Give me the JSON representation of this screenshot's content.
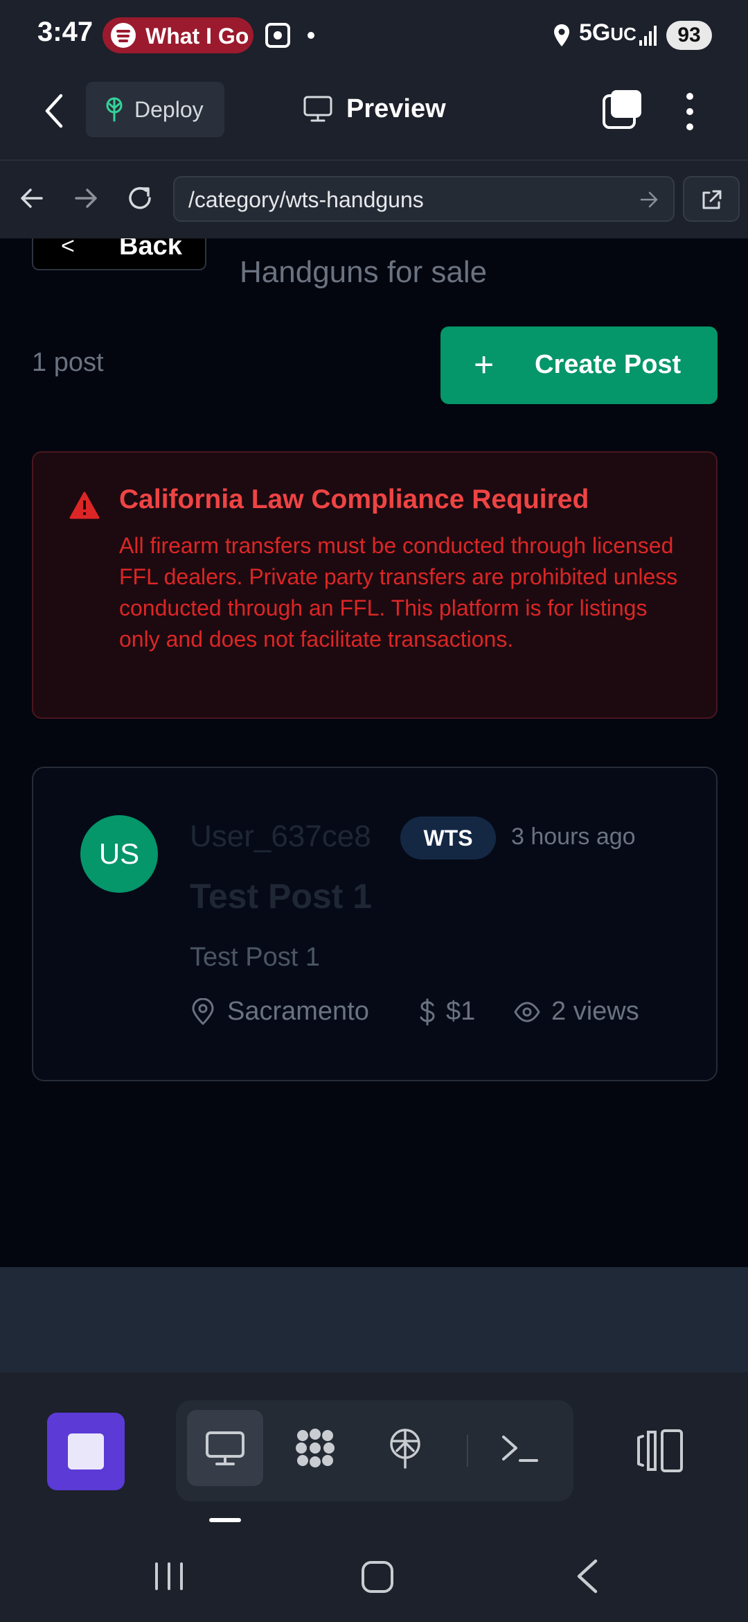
{
  "status_bar": {
    "time": "3:47",
    "media_pill": "What I Go",
    "network": "5G",
    "network_suffix": "UC",
    "battery": "93",
    "icons": [
      "spotify-icon",
      "screenshot-icon",
      "location-icon",
      "signal-icon"
    ]
  },
  "app_header": {
    "deploy_label": "Deploy",
    "preview_label": "Preview",
    "icons": [
      "back-chevron-icon",
      "deploy-tree-icon",
      "monitor-icon",
      "tabs-icon",
      "more-icon"
    ]
  },
  "url_bar": {
    "value": "/category/wts-handguns",
    "icons": [
      "arrow-left-icon",
      "arrow-right-icon",
      "reload-icon",
      "go-arrow-icon",
      "external-link-icon"
    ]
  },
  "page": {
    "back_label": "Back",
    "subtitle": "Handguns for sale",
    "post_count": "1 post",
    "create_post_label": "Create Post",
    "alert": {
      "title": "California Law Compliance Required",
      "body": "All firearm transfers must be conducted through licensed FFL dealers. Private party transfers are prohibited unless conducted through an FFL. This platform is for listings only and does not facilitate transactions."
    },
    "posts": [
      {
        "avatar": "US",
        "username": "User_637ce8",
        "badge": "WTS",
        "time": "3 hours ago",
        "title": "Test Post 1",
        "description": "Test Post 1",
        "location": "Sacramento",
        "price": "$1",
        "views": "2 views"
      }
    ]
  },
  "toolbar": {
    "icons": [
      "stop-icon",
      "monitor-icon",
      "grid-dots-icon",
      "deploy-tree-icon",
      "terminal-icon",
      "layout-icon"
    ]
  },
  "colors": {
    "accent_green": "#059669",
    "alert_red": "#ef4444",
    "stop_purple": "#5b3ad6",
    "badge_bg": "#142844"
  }
}
